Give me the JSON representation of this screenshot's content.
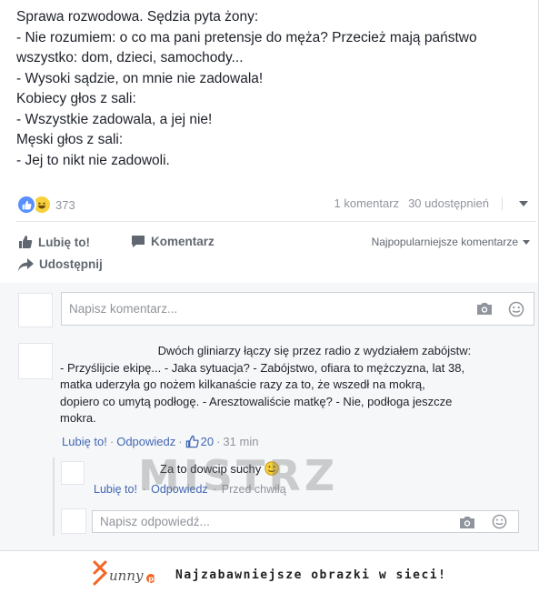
{
  "post": {
    "lines": [
      "Sprawa rozwodowa. Sędzia pyta żony:",
      "- Nie rozumiem: o co ma pani pretensje do męża? Przecież mają państwo",
      "wszystko: dom, dzieci, samochody...",
      "- Wysoki sądzie, on mnie nie zadowala!",
      "Kobiecy głos z sali:",
      "- Wszystkie zadowala, a jej nie!",
      "Męski głos z sali:",
      "- Jej to nikt nie zadowoli."
    ]
  },
  "stats": {
    "reaction_count": "373",
    "comments": "1 komentarz",
    "shares": "30 udostępnień",
    "reaction_icons": [
      "like-icon",
      "haha-icon"
    ]
  },
  "actions": {
    "like": "Lubię to!",
    "comment": "Komentarz",
    "share": "Udostępnij",
    "sort": "Najpopularniejsze komentarze"
  },
  "composer": {
    "placeholder": "Napisz komentarz..."
  },
  "comment": {
    "lines": [
      "Dwóch gliniarzy łączy się przez radio z wydziałem zabójstw:",
      "- Przyślijcie ekipę... - Jaka sytuacja? - Zabójstwo, ofiara to mężczyzna, lat 38,",
      "matka uderzyła go nożem kilkanaście razy za to, że wszedł na mokrą,",
      "dopiero co umytą podłogę. - Aresztowaliście matkę? - Nie, podłoga jeszcze",
      "mokra."
    ],
    "like": "Lubię to!",
    "reply": "Odpowiedz",
    "likes": "20",
    "time": "31 min"
  },
  "reply": {
    "text": "Za to dowcip suchy",
    "like": "Lubię to!",
    "reply": "Odpowiedz",
    "time": "Przed chwilą",
    "placeholder": "Napisz odpowiedź..."
  },
  "watermark": "MISTRZ",
  "footer": {
    "logo": "funny",
    "tagline": "Najzabawniejsze obrazki w sieci!"
  },
  "colors": {
    "link": "#4267b2",
    "muted": "#90949c",
    "like_blue": "#5890ff",
    "haha_yellow": "#f7d13c",
    "logo_orange": "#f26522"
  }
}
